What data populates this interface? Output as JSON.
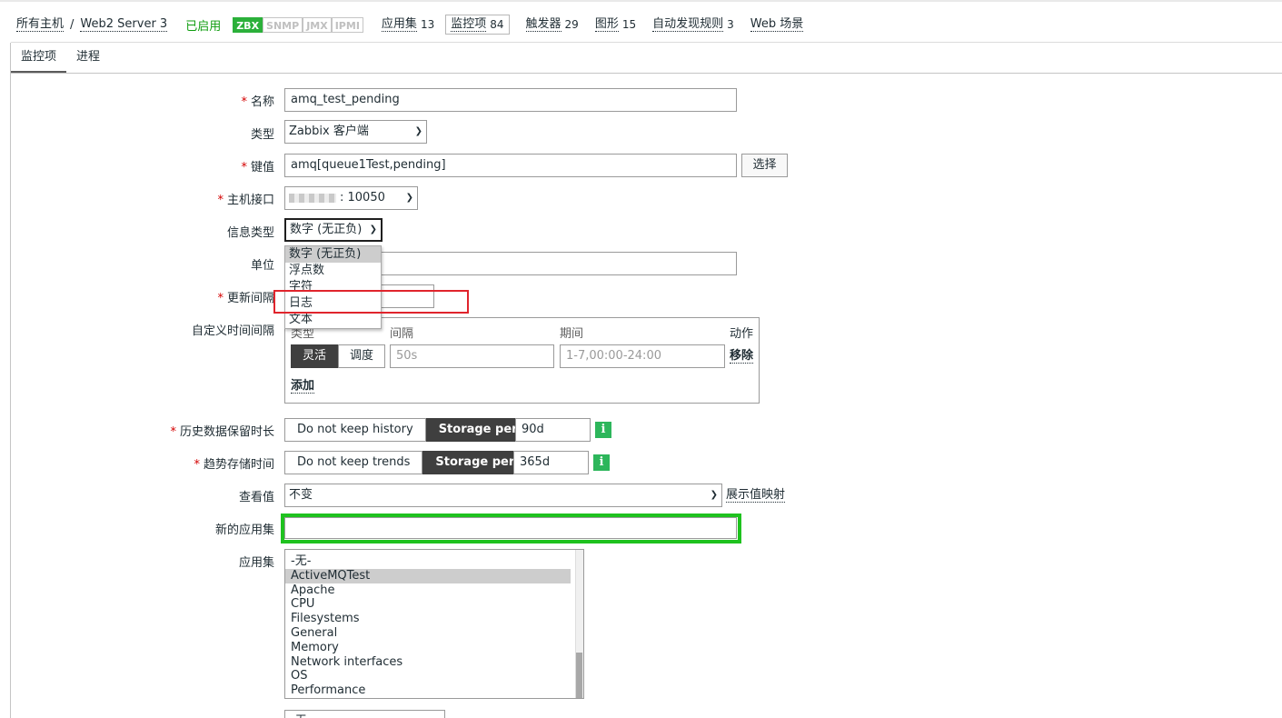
{
  "breadcrumb": {
    "all_hosts": "所有主机",
    "sep": "/",
    "host": "Web2 Server 3",
    "status": "已启用"
  },
  "protocols": [
    "ZBX",
    "SNMP",
    "JMX",
    "IPMI"
  ],
  "host_tabs": [
    {
      "label": "应用集",
      "count": "13"
    },
    {
      "label": "监控项",
      "count": "84"
    },
    {
      "label": "触发器",
      "count": "29"
    },
    {
      "label": "图形",
      "count": "15"
    },
    {
      "label": "自动发现规则",
      "count": "3"
    },
    {
      "label": "Web 场景",
      "count": ""
    }
  ],
  "sub_tabs": [
    "监控项",
    "进程"
  ],
  "form": {
    "name_label": "名称",
    "name_value": "amq_test_pending",
    "type_label": "类型",
    "type_value": "Zabbix 客户端",
    "key_label": "键值",
    "key_value": "amq[queue1Test,pending]",
    "key_select_button": "选择",
    "interface_label": "主机接口",
    "interface_value": ": 10050",
    "info_type_label": "信息类型",
    "info_type_value": "数字 (无正负)",
    "info_type_options": [
      "数字 (无正负)",
      "浮点数",
      "字符",
      "日志",
      "文本"
    ],
    "units_label": "单位",
    "interval_label": "更新间隔",
    "custom_intervals_label": "自定义时间间隔",
    "custom_intervals": {
      "col_type": "类型",
      "col_interval": "间隔",
      "col_period": "期间",
      "col_action": "动作",
      "mode_flexible": "灵活",
      "mode_scheduling": "调度",
      "interval_placeholder": "50s",
      "period_placeholder": "1-7,00:00-24:00",
      "remove": "移除",
      "add": "添加"
    },
    "history_label": "历史数据保留时长",
    "history_no_keep": "Do not keep history",
    "history_storage": "Storage period",
    "history_value": "90d",
    "trends_label": "趋势存储时间",
    "trends_no_keep": "Do not keep trends",
    "trends_storage": "Storage period",
    "trends_value": "365d",
    "info_icon": "i",
    "valuemap_label": "查看值",
    "valuemap_value": "不变",
    "valuemap_link": "展示值映射",
    "new_app_label": "新的应用集",
    "new_app_value": "",
    "apps_label": "应用集",
    "apps": [
      "-无-",
      "ActiveMQTest",
      "Apache",
      "CPU",
      "Filesystems",
      "General",
      "Memory",
      "Network interfaces",
      "OS",
      "Performance"
    ],
    "apps_selected": "ActiveMQTest",
    "bottom_partial_value": "-无-"
  },
  "icons": {
    "select_chevron": "chevron-down-icon",
    "info": "info-icon"
  },
  "colors": {
    "enabled": "#0f9d0f",
    "zbx": "#2bb03a",
    "annotation_red": "#e0242c",
    "annotation_green": "#1fc21f",
    "info_green": "#2db65b"
  }
}
